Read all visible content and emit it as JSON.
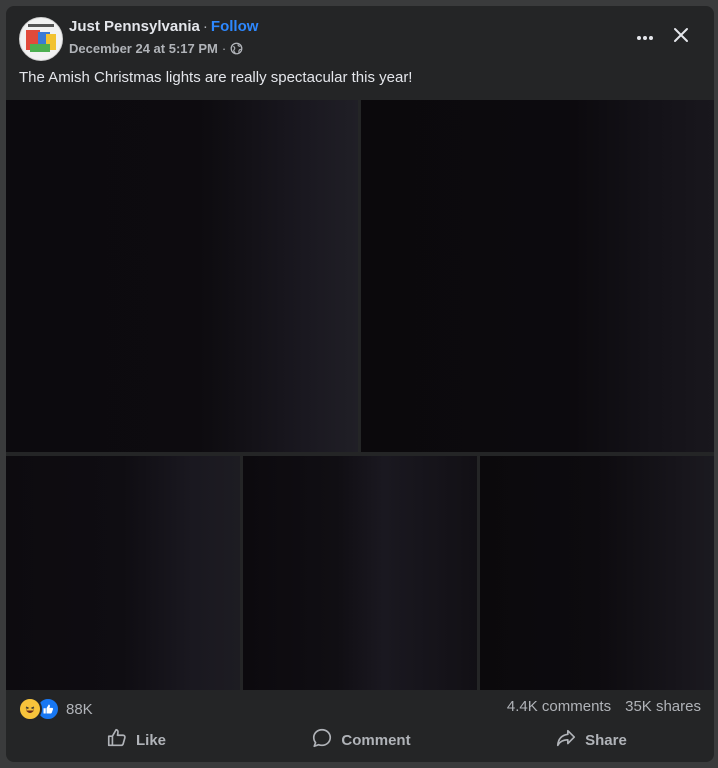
{
  "post": {
    "page_name": "Just Pennsylvania",
    "separator": "·",
    "follow_label": "Follow",
    "timestamp": "December 24 at 5:17 PM",
    "meta_separator": "·",
    "audience_icon": "globe-icon",
    "text": "The Amish Christmas lights are really spectacular this year!"
  },
  "header_actions": {
    "more_icon": "more-horizontal-icon",
    "close_icon": "close-icon"
  },
  "photos": [
    {
      "name": "photo-1"
    },
    {
      "name": "photo-2"
    },
    {
      "name": "photo-3"
    },
    {
      "name": "photo-4"
    },
    {
      "name": "photo-5"
    }
  ],
  "stats": {
    "reaction_icons": [
      "haha-icon",
      "like-icon"
    ],
    "reaction_count": "88K",
    "comments": "4.4K comments",
    "shares": "35K shares"
  },
  "actions": {
    "like_label": "Like",
    "comment_label": "Comment",
    "share_label": "Share"
  },
  "colors": {
    "background": "#242526",
    "text_primary": "#e4e6eb",
    "text_secondary": "#b0b3b8",
    "accent": "#2d88ff",
    "like_blue": "#1877f2",
    "haha_yellow": "#f7c33b"
  }
}
